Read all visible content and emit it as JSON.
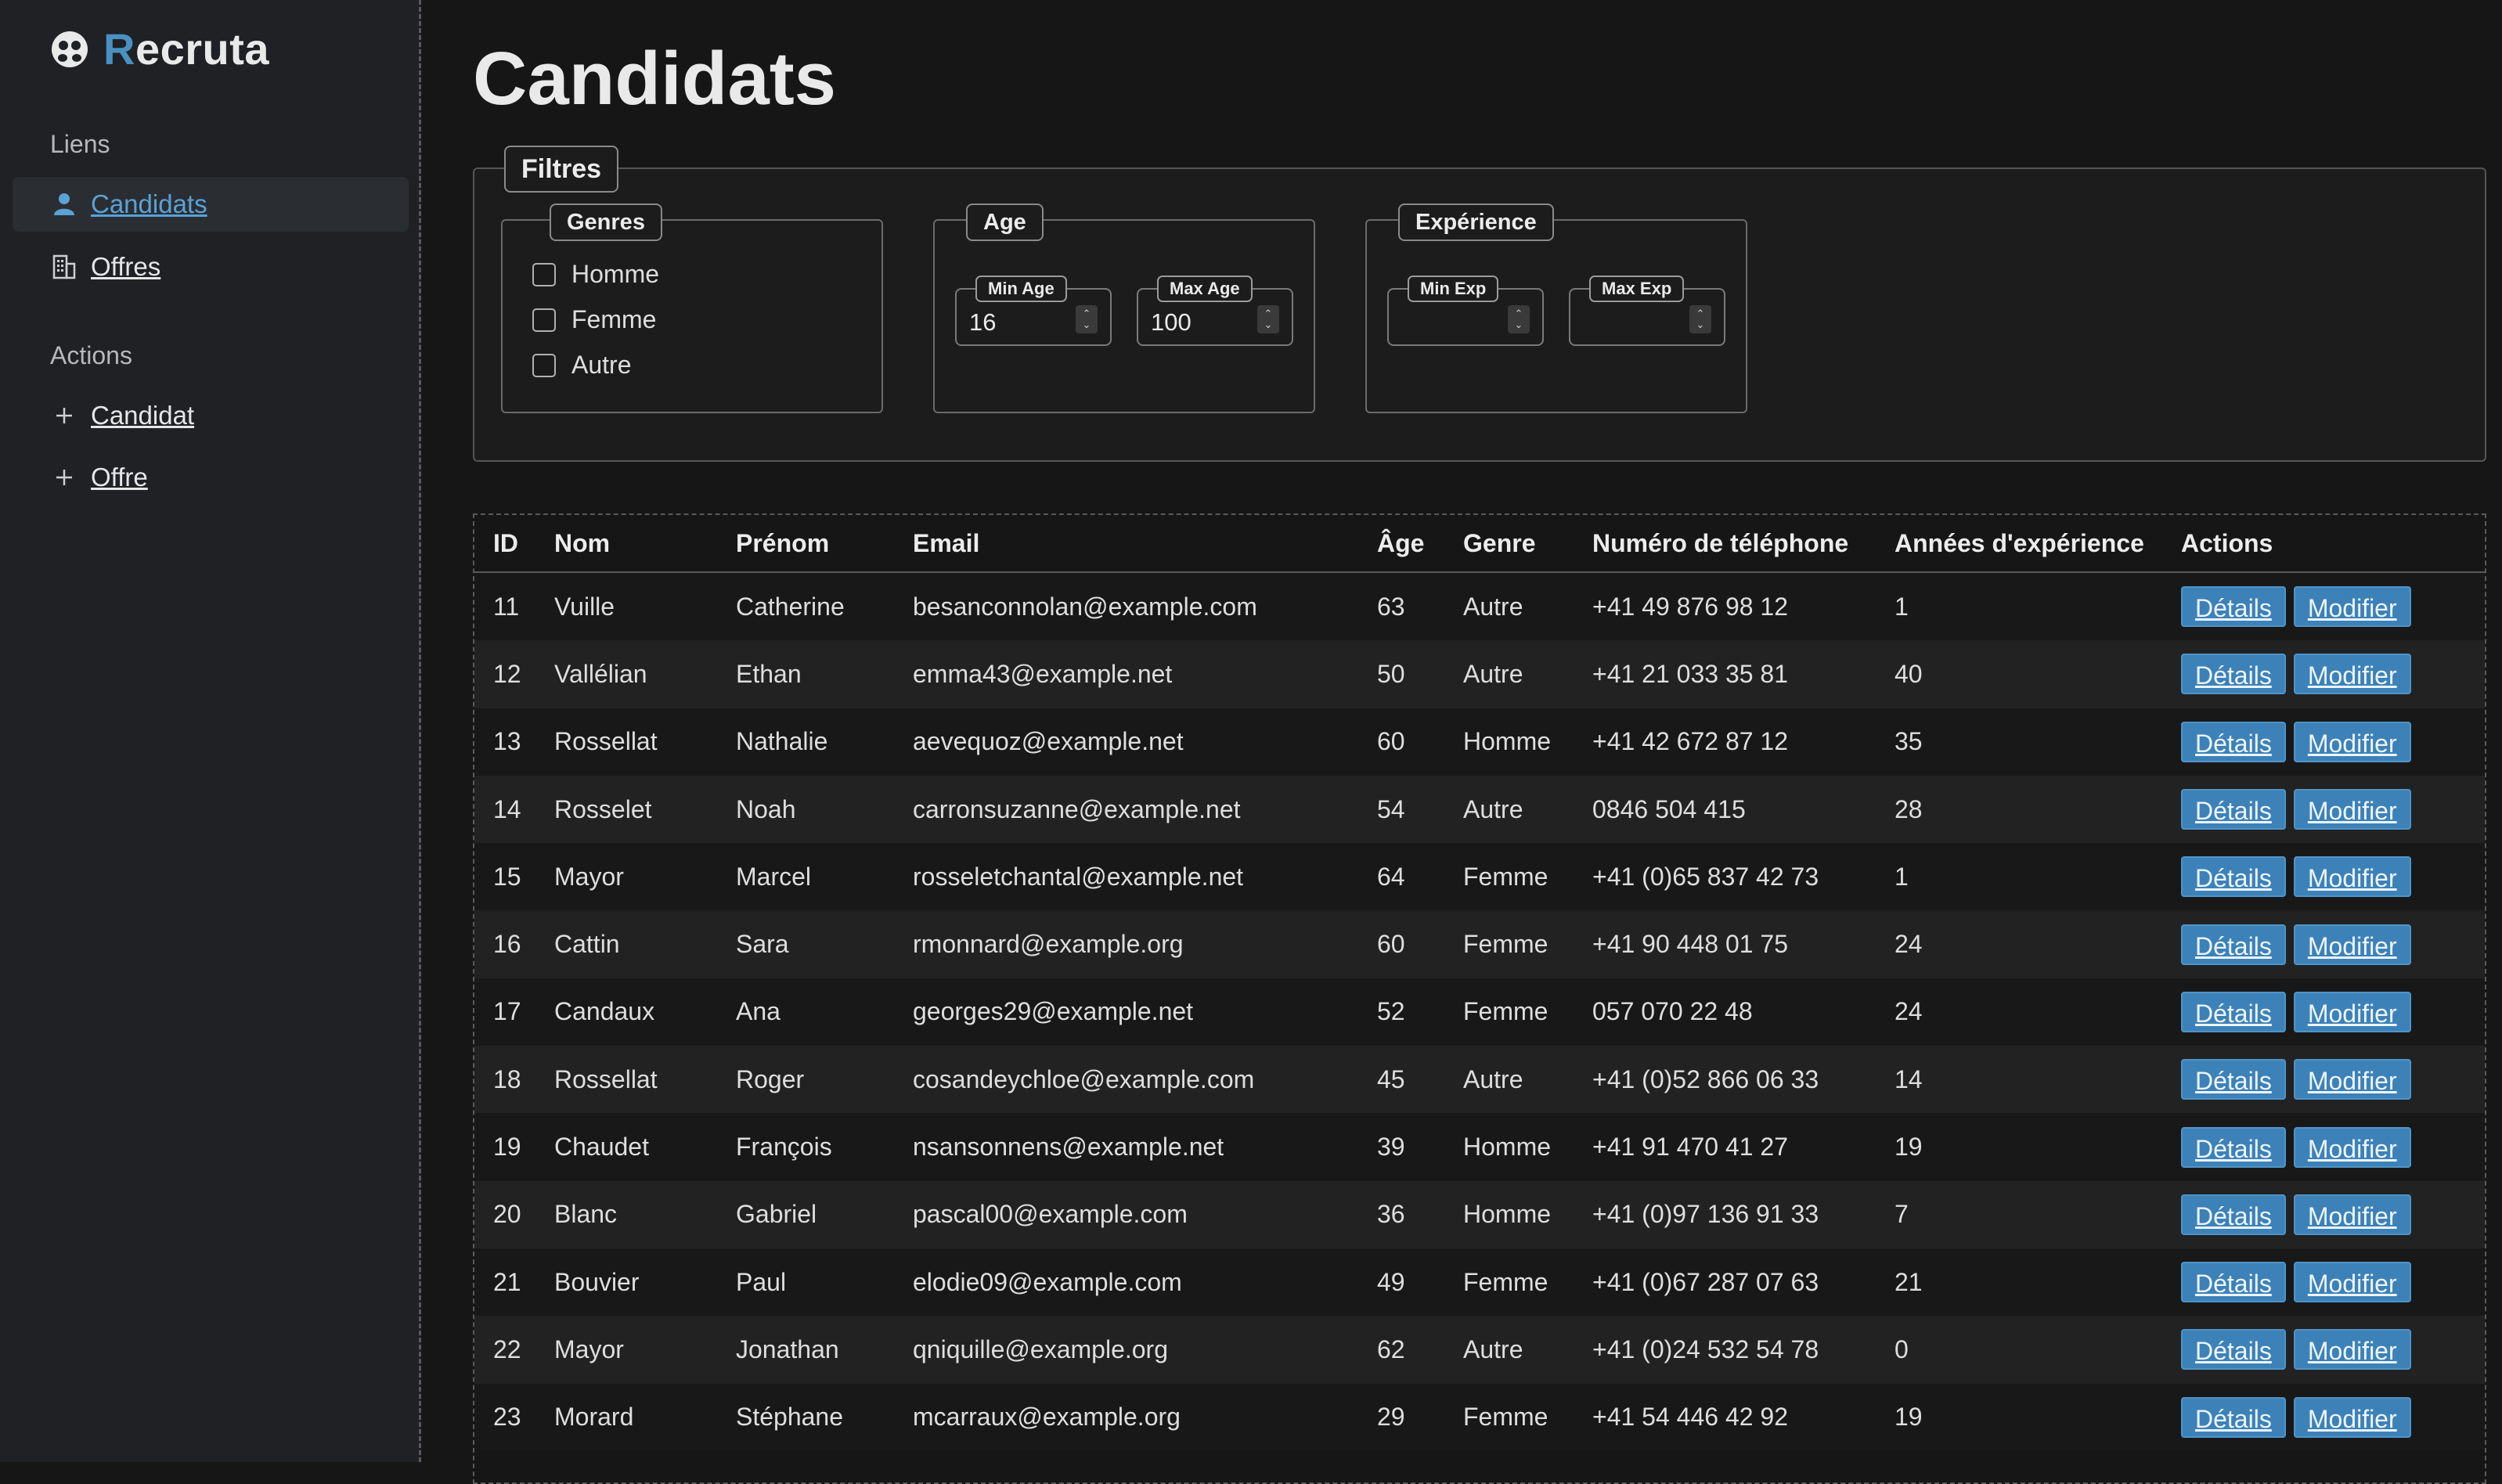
{
  "brand": {
    "first_letter": "R",
    "rest": "ecruta"
  },
  "sidebar": {
    "links_title": "Liens",
    "links": [
      {
        "label": "Candidats",
        "icon": "user-icon",
        "active": true
      },
      {
        "label": "Offres",
        "icon": "building-icon",
        "active": false
      }
    ],
    "actions_title": "Actions",
    "actions": [
      {
        "label": "Candidat",
        "icon": "plus-icon"
      },
      {
        "label": "Offre",
        "icon": "plus-icon"
      }
    ]
  },
  "page": {
    "title": "Candidats"
  },
  "filters": {
    "legend": "Filtres",
    "genres": {
      "legend": "Genres",
      "options": [
        "Homme",
        "Femme",
        "Autre"
      ]
    },
    "age": {
      "legend": "Age",
      "min_label": "Min Age",
      "min_value": "16",
      "max_label": "Max Age",
      "max_value": "100"
    },
    "experience": {
      "legend": "Expérience",
      "min_label": "Min Exp",
      "min_value": "",
      "max_label": "Max Exp",
      "max_value": ""
    }
  },
  "table": {
    "headers": [
      "ID",
      "Nom",
      "Prénom",
      "Email",
      "Âge",
      "Genre",
      "Numéro de téléphone",
      "Années d'expérience",
      "Actions"
    ],
    "details_label": "Détails",
    "edit_label": "Modifier",
    "rows": [
      [
        "11",
        "Vuille",
        "Catherine",
        "besanconnolan@example.com",
        "63",
        "Autre",
        "+41 49 876 98 12",
        "1"
      ],
      [
        "12",
        "Vallélian",
        "Ethan",
        "emma43@example.net",
        "50",
        "Autre",
        "+41 21 033 35 81",
        "40"
      ],
      [
        "13",
        "Rossellat",
        "Nathalie",
        "aevequoz@example.net",
        "60",
        "Homme",
        "+41 42 672 87 12",
        "35"
      ],
      [
        "14",
        "Rosselet",
        "Noah",
        "carronsuzanne@example.net",
        "54",
        "Autre",
        "0846 504 415",
        "28"
      ],
      [
        "15",
        "Mayor",
        "Marcel",
        "rosseletchantal@example.net",
        "64",
        "Femme",
        "+41 (0)65 837 42 73",
        "1"
      ],
      [
        "16",
        "Cattin",
        "Sara",
        "rmonnard@example.org",
        "60",
        "Femme",
        "+41 90 448 01 75",
        "24"
      ],
      [
        "17",
        "Candaux",
        "Ana",
        "georges29@example.net",
        "52",
        "Femme",
        "057 070 22 48",
        "24"
      ],
      [
        "18",
        "Rossellat",
        "Roger",
        "cosandeychloe@example.com",
        "45",
        "Autre",
        "+41 (0)52 866 06 33",
        "14"
      ],
      [
        "19",
        "Chaudet",
        "François",
        "nsansonnens@example.net",
        "39",
        "Homme",
        "+41 91 470 41 27",
        "19"
      ],
      [
        "20",
        "Blanc",
        "Gabriel",
        "pascal00@example.com",
        "36",
        "Homme",
        "+41 (0)97 136 91 33",
        "7"
      ],
      [
        "21",
        "Bouvier",
        "Paul",
        "elodie09@example.com",
        "49",
        "Femme",
        "+41 (0)67 287 07 63",
        "21"
      ],
      [
        "22",
        "Mayor",
        "Jonathan",
        "qniquille@example.org",
        "62",
        "Autre",
        "+41 (0)24 532 54 78",
        "0"
      ],
      [
        "23",
        "Morard",
        "Stéphane",
        "mcarraux@example.org",
        "29",
        "Femme",
        "+41 54 446 42 92",
        "19"
      ]
    ]
  }
}
